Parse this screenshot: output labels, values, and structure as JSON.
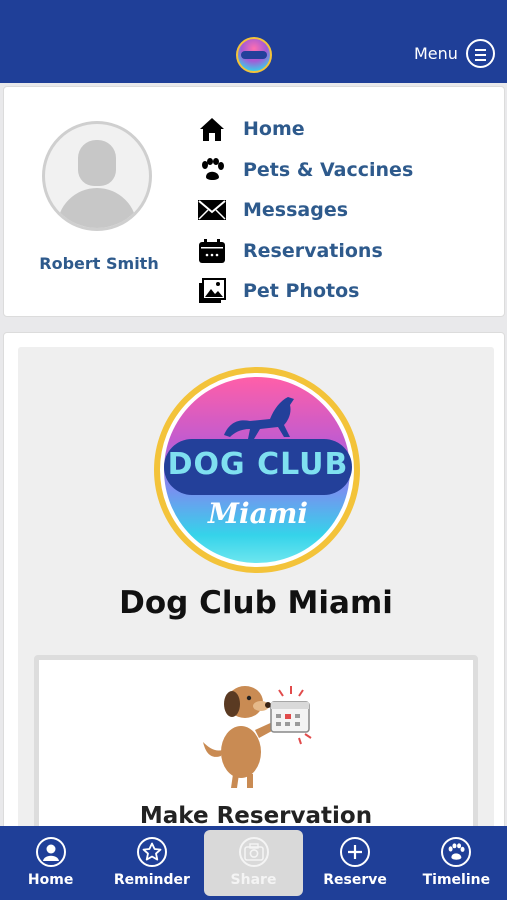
{
  "header": {
    "menu_label": "Menu"
  },
  "profile": {
    "name": "Robert Smith"
  },
  "nav": {
    "items": [
      {
        "label": "Home",
        "icon": "house-icon"
      },
      {
        "label": "Pets & Vaccines",
        "icon": "paw-icon"
      },
      {
        "label": "Messages",
        "icon": "envelope-icon"
      },
      {
        "label": "Reservations",
        "icon": "calendar-icon"
      },
      {
        "label": "Pet Photos",
        "icon": "photos-icon"
      }
    ]
  },
  "club": {
    "logo_top": "DOG CLUB",
    "logo_script": "Miami",
    "title": "Dog Club Miami"
  },
  "reserve_card": {
    "label": "Make Reservation"
  },
  "bottom_nav": {
    "items": [
      {
        "label": "Home",
        "icon": "user-circle-icon"
      },
      {
        "label": "Reminder",
        "icon": "star-icon"
      },
      {
        "label": "Share",
        "icon": "camera-icon"
      },
      {
        "label": "Reserve",
        "icon": "plus-icon"
      },
      {
        "label": "Timeline",
        "icon": "paw-icon"
      }
    ],
    "active": "Share"
  },
  "colors": {
    "brand_blue": "#1f3f98",
    "link_blue": "#2e5a8c",
    "gold": "#f3c33a"
  }
}
